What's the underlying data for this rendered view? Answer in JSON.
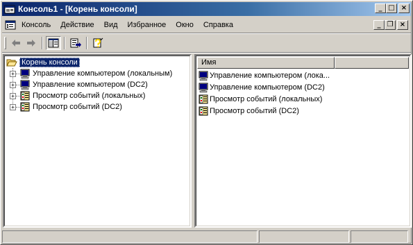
{
  "window": {
    "title": "Консоль1 - [Корень консоли]",
    "controls": {
      "minimize": "_",
      "maximize": "□",
      "close": "×"
    }
  },
  "menu": {
    "items": [
      {
        "label": "Консоль"
      },
      {
        "label": "Действие"
      },
      {
        "label": "Вид"
      },
      {
        "label": "Избранное"
      },
      {
        "label": "Окно"
      },
      {
        "label": "Справка"
      }
    ],
    "child_controls": {
      "minimize": "_",
      "restore": "❐",
      "close": "×"
    }
  },
  "toolbar": {
    "back_icon": "back-arrow-icon",
    "forward_icon": "forward-arrow-icon",
    "tree_toggle_icon": "show-hide-tree-icon",
    "export_list_icon": "export-list-icon",
    "help_icon": "help-icon"
  },
  "tree": {
    "root": {
      "label": "Корень консоли",
      "icon": "folder-open-icon"
    },
    "children": [
      {
        "label": "Управление компьютером (локальным)",
        "icon": "computer-management-icon",
        "expander": "+"
      },
      {
        "label": "Управление компьютером (DC2)",
        "icon": "computer-management-icon",
        "expander": "+"
      },
      {
        "label": "Просмотр событий (локальных)",
        "icon": "event-viewer-icon",
        "expander": "+"
      },
      {
        "label": "Просмотр событий (DC2)",
        "icon": "event-viewer-icon",
        "expander": "+"
      }
    ]
  },
  "list": {
    "columns": [
      {
        "label": "Имя"
      }
    ],
    "items": [
      {
        "label": "Управление компьютером (лока...",
        "icon": "computer-management-icon"
      },
      {
        "label": "Управление компьютером (DC2)",
        "icon": "computer-management-icon"
      },
      {
        "label": "Просмотр событий (локальных)",
        "icon": "event-viewer-icon"
      },
      {
        "label": "Просмотр событий (DC2)",
        "icon": "event-viewer-icon"
      }
    ]
  },
  "colors": {
    "title_active": "#0a246a",
    "title_gradient_end": "#a6caf0",
    "face": "#d4d0c8",
    "selection": "#0a246a"
  }
}
